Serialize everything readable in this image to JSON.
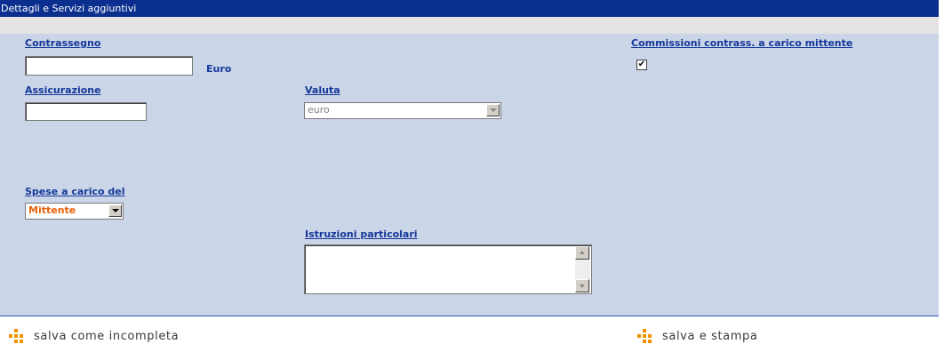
{
  "header": {
    "title": "Dettagli e Servizi aggiuntivi"
  },
  "form": {
    "contrassegno": {
      "label": "Contrassegno",
      "value": "",
      "unit": "Euro"
    },
    "commissioni": {
      "label": "Commissioni contrass. a carico mittente",
      "checked": true,
      "check_glyph": "✔"
    },
    "assicurazione": {
      "label": "Assicurazione",
      "value": ""
    },
    "valuta": {
      "label": "Valuta",
      "selected": "euro",
      "disabled": true
    },
    "spese": {
      "label": "Spese a carico del",
      "selected": "Mittente",
      "color": "#e8610a"
    },
    "istruzioni": {
      "label": "Istruzioni particolari",
      "value": ""
    }
  },
  "actions": {
    "save_incomplete": "salva come incompleta",
    "save_print": "salva e stampa"
  },
  "colors": {
    "title_bar": "#0b2f8e",
    "panel": "#cbd5e8",
    "label": "#15389a",
    "icon": "#f39200"
  }
}
